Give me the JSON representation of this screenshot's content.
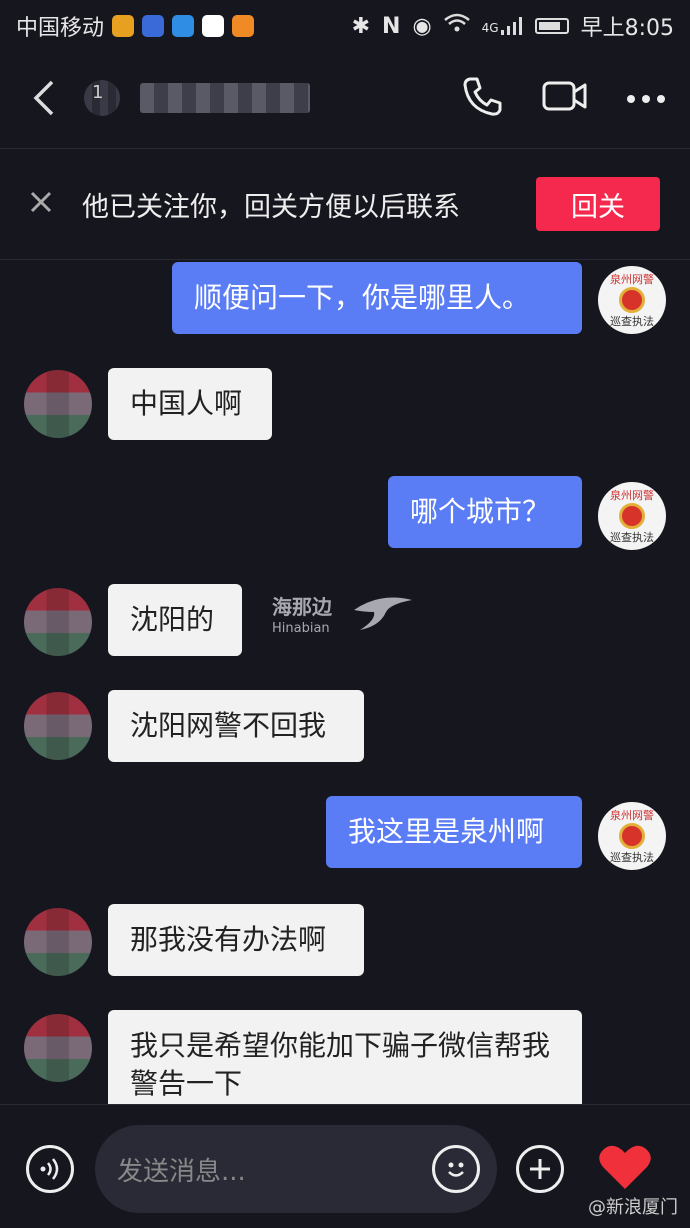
{
  "status": {
    "carrier": "中国移动",
    "time": "早上8:05",
    "network": "4G"
  },
  "header": {
    "badge": "1"
  },
  "banner": {
    "text": "他已关注你，回关方便以后联系",
    "button": "回关"
  },
  "police_avatar": {
    "top": "泉州网警",
    "bottom": "巡查执法"
  },
  "messages": [
    {
      "side": "out",
      "text": "顺便问一下，你是哪里人。"
    },
    {
      "side": "in",
      "text": "中国人啊"
    },
    {
      "side": "out",
      "text": "哪个城市？"
    },
    {
      "side": "in",
      "text": "沈阳的"
    },
    {
      "side": "in",
      "text": "沈阳网警不回我"
    },
    {
      "side": "out",
      "text": "我这里是泉州啊"
    },
    {
      "side": "in",
      "text": "那我没有办法啊"
    },
    {
      "side": "in",
      "text": "我只是希望你能加下骗子微信帮我警告一下"
    }
  ],
  "watermark": {
    "main": "海那边",
    "sub": "Hinabian"
  },
  "input": {
    "placeholder": "发送消息..."
  },
  "credit": "@新浪厦门",
  "colors": {
    "accent": "#f5284d",
    "out_bubble": "#5a7cf5",
    "in_bubble": "#f2f2f2"
  }
}
